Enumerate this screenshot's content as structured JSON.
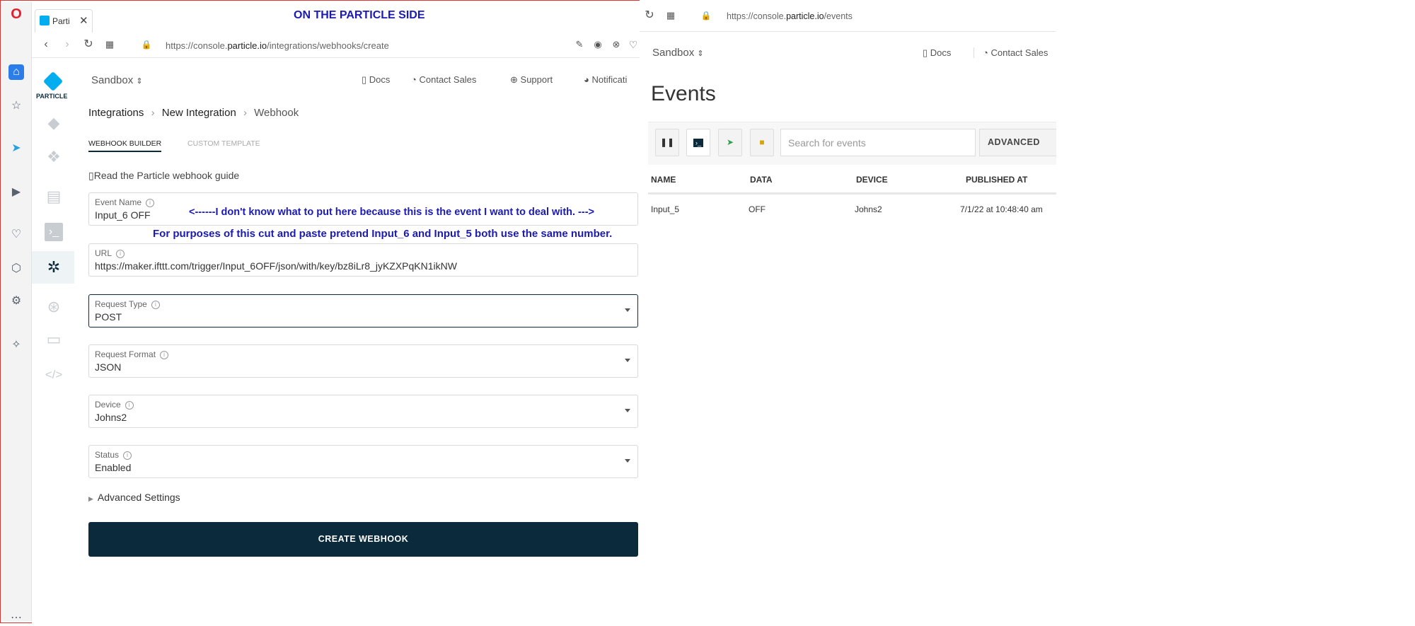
{
  "annotations": {
    "heading": "ON THE PARTICLE SIDE",
    "note1": "<------I don't know what to put here because this is the event I want to deal with. --->",
    "note2": "For purposes of this cut and paste pretend Input_6  and Input_5 both use the same number."
  },
  "left_browser": {
    "tab_title": "Parti",
    "url_prefix": "https://console.",
    "url_domain": "particle.io",
    "url_path": "/integrations/webhooks/create"
  },
  "particle_sidebar": {
    "logo_text": "PARTICLE"
  },
  "topnav": {
    "org": "Sandbox",
    "docs": "Docs",
    "contact": "Contact Sales",
    "support": "Support",
    "notifications": "Notificati"
  },
  "breadcrumb": [
    "Integrations",
    "New Integration",
    "Webhook"
  ],
  "tabs": [
    "WEBHOOK BUILDER",
    "CUSTOM TEMPLATE"
  ],
  "guide_link": "Read the Particle webhook guide",
  "form": {
    "event_name": {
      "label": "Event Name",
      "value": "Input_6 OFF"
    },
    "url": {
      "label": "URL",
      "value": "https://maker.ifttt.com/trigger/Input_6OFF/json/with/key/bz8iLr8_jyKZXPqKN1ikNW"
    },
    "request_type": {
      "label": "Request Type",
      "value": "POST"
    },
    "request_format": {
      "label": "Request Format",
      "value": "JSON"
    },
    "device": {
      "label": "Device",
      "value": "Johns2"
    },
    "status": {
      "label": "Status",
      "value": "Enabled"
    },
    "advanced": "Advanced Settings",
    "submit": "CREATE WEBHOOK"
  },
  "right_browser": {
    "url_prefix": "https://console.",
    "url_domain": "particle.io",
    "url_path": "/events",
    "org": "Sandbox",
    "docs": "Docs",
    "contact": "Contact Sales",
    "title": "Events",
    "search_placeholder": "Search for events",
    "advanced_button": "ADVANCED",
    "columns": [
      "NAME",
      "DATA",
      "DEVICE",
      "PUBLISHED AT"
    ],
    "rows": [
      [
        "Input_5",
        "OFF",
        "Johns2",
        "7/1/22 at 10:48:40 am"
      ]
    ]
  },
  "colors": {
    "accent": "#0b2a3c",
    "annotation": "#1b1bb4",
    "particle_blue": "#00aeef"
  }
}
